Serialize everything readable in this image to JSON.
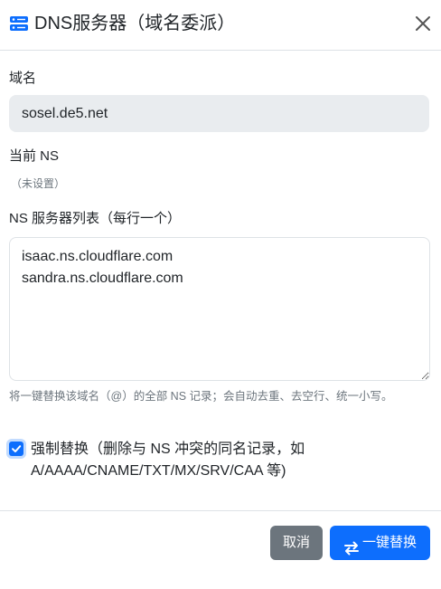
{
  "header": {
    "title": "DNS服务器（域名委派）",
    "icon": "server-icon",
    "close_icon": "close-icon"
  },
  "domain": {
    "label": "域名",
    "value": "sosel.de5.net"
  },
  "current_ns": {
    "label": "当前 NS",
    "value": "（未设置）"
  },
  "ns_list": {
    "label": "NS 服务器列表（每行一个）",
    "value": "isaac.ns.cloudflare.com\nsandra.ns.cloudflare.com",
    "help": "将一键替换该域名（@）的全部 NS 记录；会自动去重、去空行、统一小写。"
  },
  "force_replace": {
    "checked": true,
    "label": "强制替换（删除与 NS 冲突的同名记录，如 A/AAAA/CNAME/TXT/MX/SRV/CAA 等)"
  },
  "footer": {
    "cancel_label": "取消",
    "replace_label": "一键替换",
    "replace_icon": "swap-arrows-icon"
  },
  "colors": {
    "primary": "#0d6efd",
    "secondary": "#6c757d",
    "field_bg": "#e9ecef",
    "muted_text": "#6c757d"
  }
}
